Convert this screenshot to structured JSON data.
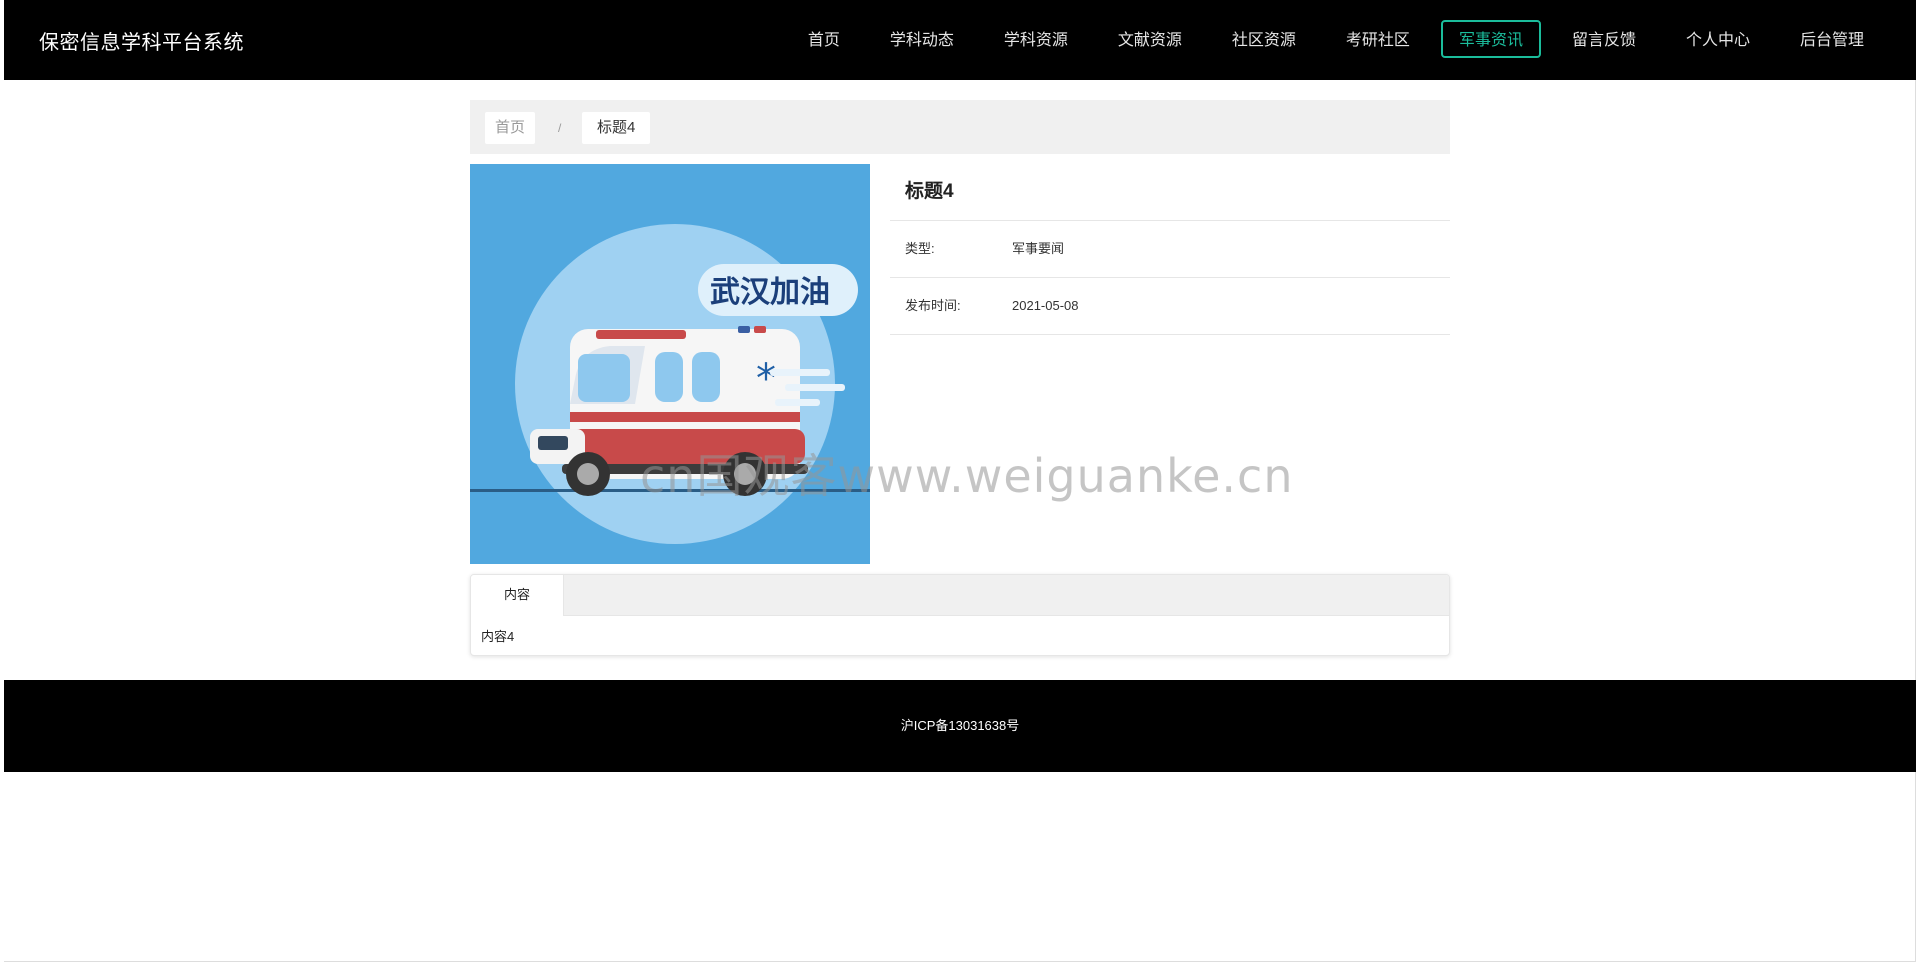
{
  "header": {
    "brand": "保密信息学科平台系统",
    "nav": [
      {
        "label": "首页"
      },
      {
        "label": "学科动态"
      },
      {
        "label": "学科资源"
      },
      {
        "label": "文献资源"
      },
      {
        "label": "社区资源"
      },
      {
        "label": "考研社区"
      },
      {
        "label": "军事资讯",
        "active": true
      },
      {
        "label": "留言反馈"
      },
      {
        "label": "个人中心"
      },
      {
        "label": "后台管理"
      }
    ]
  },
  "breadcrumb": {
    "home": "首页",
    "separator": "/",
    "current": "标题4"
  },
  "article": {
    "title": "标题4",
    "type_label": "类型:",
    "type_value": "军事要闻",
    "date_label": "发布时间:",
    "date_value": "2021-05-08",
    "cover_text": "武汉加油"
  },
  "tabs": {
    "tab_label": "内容",
    "content": "内容4"
  },
  "footer": {
    "icp": "沪ICP备13031638号"
  },
  "watermark": "cn国观客www.weiguanke.cn",
  "colors": {
    "header_bg": "#000000",
    "accent": "#1bbc9b",
    "cover_bg": "#51a8df"
  }
}
